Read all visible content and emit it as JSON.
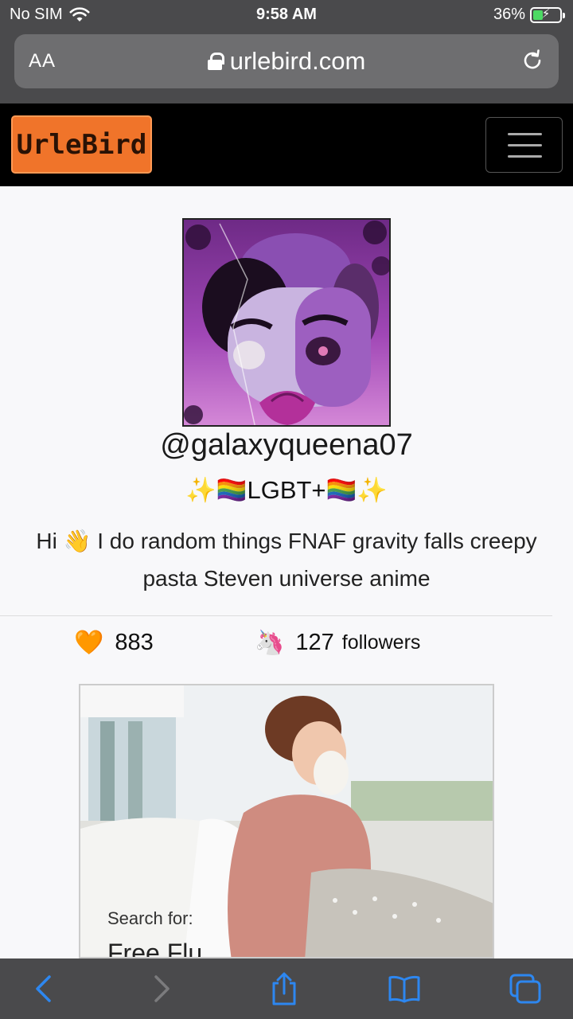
{
  "status_bar": {
    "carrier": "No SIM",
    "time": "9:58 AM",
    "battery": "36%",
    "battery_level": 0.36
  },
  "browser": {
    "text_size_label": "AA",
    "url": "urlebird.com"
  },
  "site": {
    "logo": "UrleBird"
  },
  "profile": {
    "username": "@galaxyqueena07",
    "tagline": "✨🏳️‍🌈LGBT+🏳️‍🌈✨",
    "bio": "Hi 👋 I do random things FNAF gravity falls creepy pasta Steven universe anime",
    "likes_icon": "🧡",
    "likes": "883",
    "followers_icon": "🦄",
    "followers_count": "127",
    "followers_label": "followers"
  },
  "ad": {
    "search_for": "Search for:",
    "headline": "Free Flu"
  },
  "colors": {
    "brand": "#f0742a",
    "accent": "#2d87f0",
    "chrome": "#4a4a4c"
  }
}
